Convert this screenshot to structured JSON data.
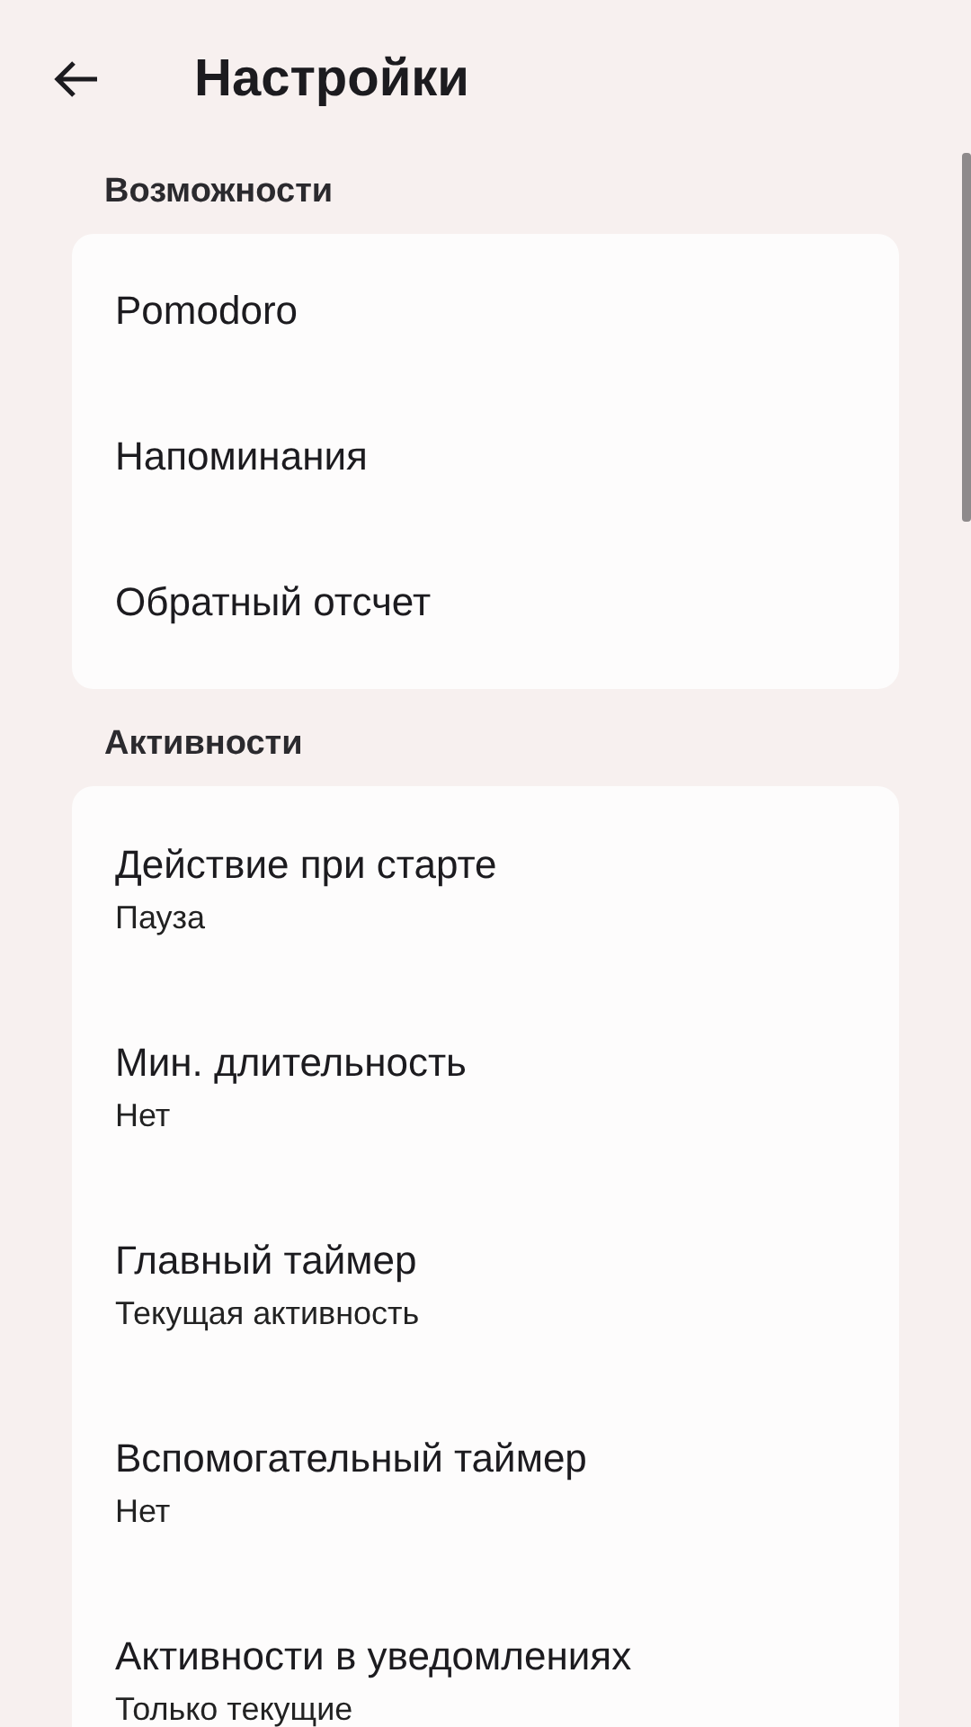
{
  "header": {
    "title": "Настройки"
  },
  "sections": [
    {
      "title": "Возможности",
      "items": [
        {
          "title": "Pomodoro"
        },
        {
          "title": "Напоминания"
        },
        {
          "title": "Обратный отсчет"
        }
      ]
    },
    {
      "title": "Активности",
      "items": [
        {
          "title": "Действие при старте",
          "value": "Пауза"
        },
        {
          "title": "Мин. длительность",
          "value": "Нет"
        },
        {
          "title": "Главный таймер",
          "value": "Текущая активность"
        },
        {
          "title": "Вспомогательный таймер",
          "value": "Нет"
        },
        {
          "title": "Активности в уведомлениях",
          "value": "Только текущие"
        }
      ]
    }
  ]
}
